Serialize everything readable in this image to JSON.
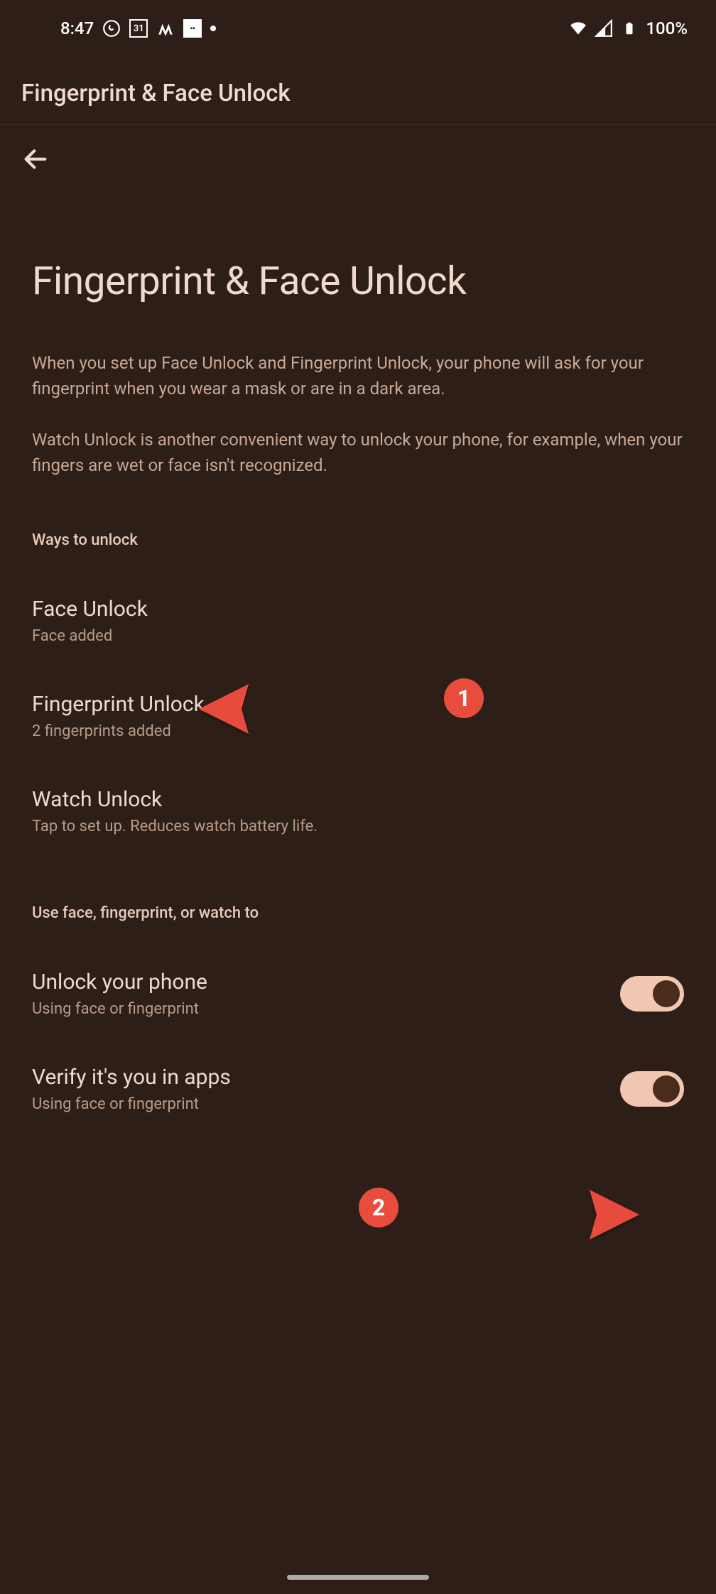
{
  "status": {
    "time": "8:47",
    "battery": "100%",
    "calendar_day": "31"
  },
  "app_bar": {
    "title": "Fingerprint & Face Unlock"
  },
  "page": {
    "title": "Fingerprint & Face Unlock",
    "desc1": "When you set up Face Unlock and Fingerprint Unlock, your phone will ask for your fingerprint when you wear a mask or are in a dark area.",
    "desc2": "Watch Unlock is another convenient way to unlock your phone, for example, when your fingers are wet or face isn't recognized."
  },
  "sections": {
    "ways_header": "Ways to unlock",
    "use_header": "Use face, fingerprint, or watch to"
  },
  "items": {
    "face": {
      "title": "Face Unlock",
      "subtitle": "Face added"
    },
    "fingerprint": {
      "title": "Fingerprint Unlock",
      "subtitle": "2 fingerprints added"
    },
    "watch": {
      "title": "Watch Unlock",
      "subtitle": "Tap to set up. Reduces watch battery life."
    },
    "unlock_phone": {
      "title": "Unlock your phone",
      "subtitle": "Using face or fingerprint"
    },
    "verify_apps": {
      "title": "Verify it's you in apps",
      "subtitle": "Using face or fingerprint"
    }
  },
  "annotations": {
    "badge1": "1",
    "badge2": "2"
  }
}
